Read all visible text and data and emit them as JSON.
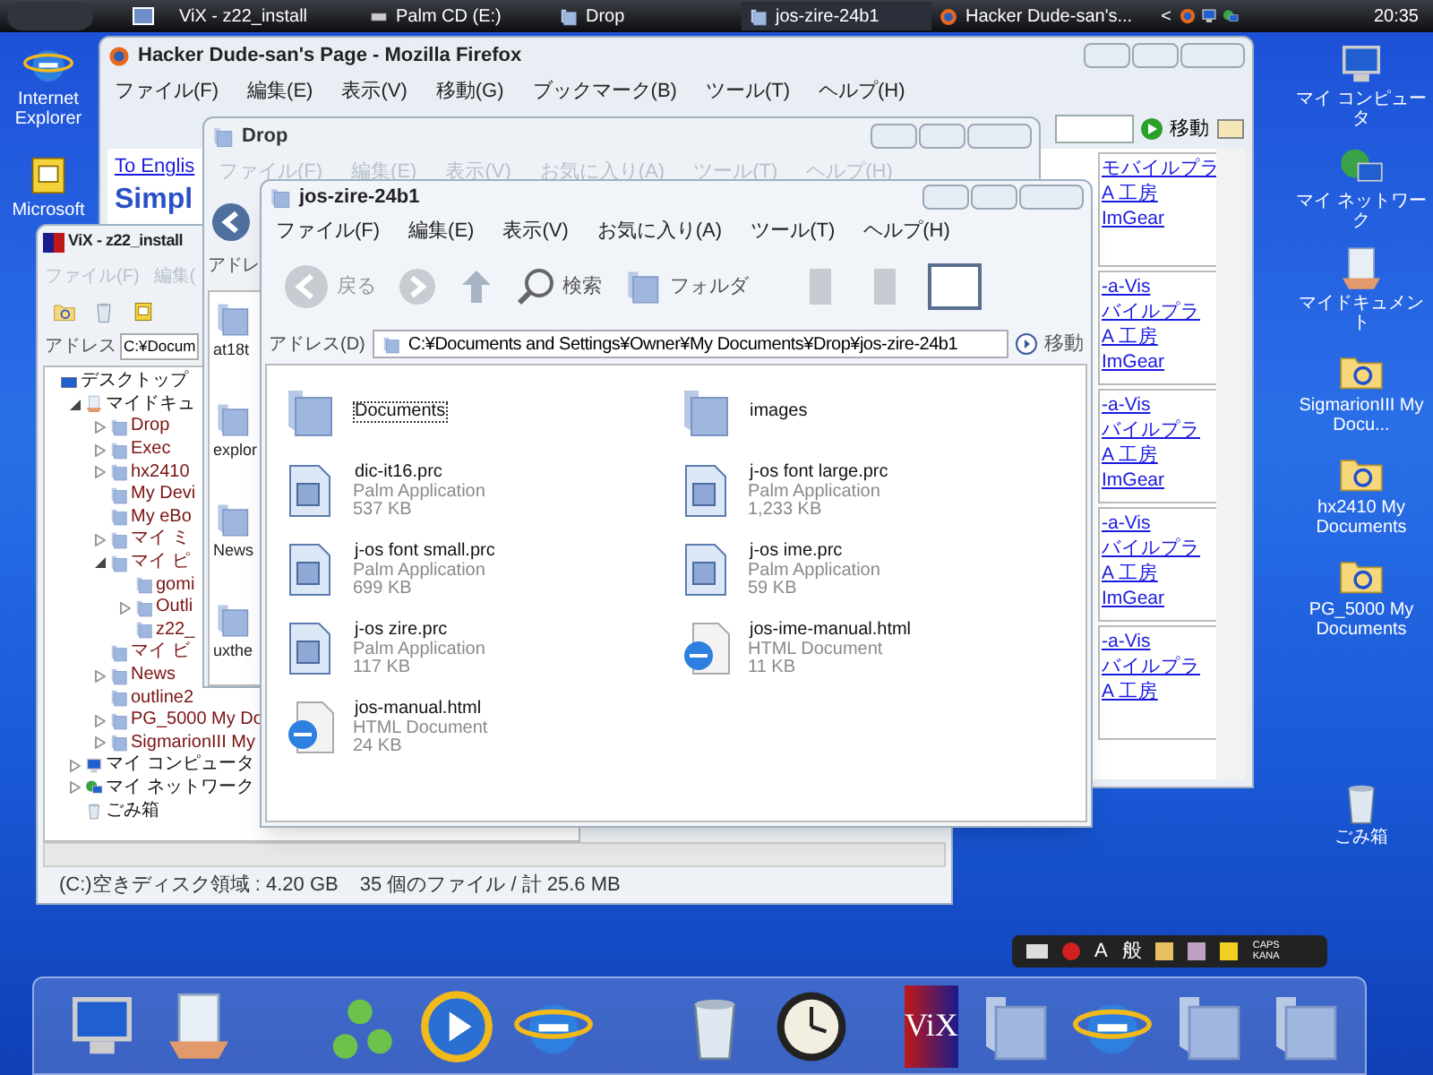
{
  "taskbar": {
    "tasks": [
      {
        "label": "ViX - z22_install",
        "kind": "vix",
        "selected": false
      },
      {
        "label": "Palm CD (E:)",
        "kind": "drive",
        "selected": false
      },
      {
        "label": "Drop",
        "kind": "folder",
        "selected": false
      },
      {
        "label": "jos-zire-24b1",
        "kind": "folder",
        "selected": true
      },
      {
        "label": "Hacker Dude-san's...",
        "kind": "browser",
        "selected": false
      }
    ],
    "tray_arrow": "<",
    "clock": "20:35"
  },
  "desktop_left": [
    {
      "label": "Internet Explorer",
      "kind": "ie"
    },
    {
      "label": "Microsoft",
      "kind": "app"
    }
  ],
  "desktop_right": [
    {
      "label": "マイ コンピュータ",
      "kind": "computer"
    },
    {
      "label": "マイ ネットワーク",
      "kind": "network"
    },
    {
      "label": "マイドキュメント",
      "kind": "docs"
    },
    {
      "label": "SigmarionIII My Docu...",
      "kind": "sync"
    },
    {
      "label": "hx2410 My Documents",
      "kind": "sync"
    },
    {
      "label": "PG_5000 My Documents",
      "kind": "sync"
    },
    {
      "label": "ごみ箱",
      "kind": "trash"
    }
  ],
  "firefox": {
    "title": "Hacker Dude-san's Page - Mozilla Firefox",
    "menu": [
      "ファイル(F)",
      "編集(E)",
      "表示(V)",
      "移動(G)",
      "ブックマーク(B)",
      "ツール(T)",
      "ヘルプ(H)"
    ],
    "go": "移動",
    "english_link": "To Englis",
    "heading": "Simpl",
    "link_groups": [
      [
        "モバイルプラ",
        "A 工房",
        "ImGear"
      ],
      [
        "-a-Vis",
        "バイルプラ",
        "A 工房",
        "ImGear"
      ],
      [
        "-a-Vis",
        "バイルプラ",
        "A 工房",
        "ImGear"
      ],
      [
        "-a-Vis",
        "バイルプラ",
        "A 工房",
        "ImGear"
      ],
      [
        "-a-Vis",
        "バイルプラ",
        "A 工房"
      ]
    ]
  },
  "vix": {
    "title": "ViX - z22_install",
    "menu": [
      "ファイル(F)",
      "編集("
    ],
    "address_label": "アドレス",
    "address": "C:¥Docum",
    "tree": [
      {
        "label": "デスクトップ",
        "kind": "desktop",
        "children": [
          {
            "label": "マイドキュ",
            "kind": "docs",
            "expanded": true,
            "children": [
              {
                "label": "Drop",
                "kind": "folder",
                "expanded": false
              },
              {
                "label": "Exec",
                "kind": "folder",
                "expanded": false
              },
              {
                "label": "hx2410",
                "kind": "folder",
                "expanded": false
              },
              {
                "label": "My Devi",
                "kind": "folder"
              },
              {
                "label": "My eBo",
                "kind": "folder"
              },
              {
                "label": "マイ ミ",
                "kind": "folder",
                "expanded": false
              },
              {
                "label": "マイ ピ",
                "kind": "folder",
                "expanded": true,
                "children": [
                  {
                    "label": "gomi",
                    "kind": "folder"
                  },
                  {
                    "label": "Outli",
                    "kind": "folder",
                    "expanded": false
                  },
                  {
                    "label": "z22_",
                    "kind": "folder"
                  }
                ]
              },
              {
                "label": "マイ ビ",
                "kind": "folder"
              },
              {
                "label": "News",
                "kind": "folder",
                "expanded": false
              },
              {
                "label": "outline2",
                "kind": "folder"
              },
              {
                "label": "PG_5000 My Do",
                "kind": "folder",
                "expanded": false
              },
              {
                "label": "SigmarionIII My",
                "kind": "folder",
                "expanded": false
              }
            ]
          },
          {
            "label": "マイ コンピュータ",
            "kind": "computer",
            "expanded": false
          },
          {
            "label": "マイ ネットワーク",
            "kind": "network",
            "expanded": false
          },
          {
            "label": "ごみ箱",
            "kind": "trash"
          }
        ]
      }
    ],
    "status": [
      "(C:)空きディスク領域 : 4.20 GB",
      "35 個のファイル / 計 25.6 MB"
    ]
  },
  "drop": {
    "title": "Drop",
    "menu": [
      "ファイル(F)",
      "編集(E)",
      "表示(V)",
      "お気に入り(A)",
      "ツール(T)",
      "ヘルプ(H)"
    ],
    "address_label": "アドレ",
    "files": [
      "at18t",
      "explor",
      "News",
      "uxthe"
    ]
  },
  "explorer": {
    "title": "jos-zire-24b1",
    "menu": [
      "ファイル(F)",
      "編集(E)",
      "表示(V)",
      "お気に入り(A)",
      "ツール(T)",
      "ヘルプ(H)"
    ],
    "back": "戻る",
    "search": "検索",
    "folders": "フォルダ",
    "address_label": "アドレス(D)",
    "address": "C:¥Documents and Settings¥Owner¥My Documents¥Drop¥jos-zire-24b1",
    "go": "移動",
    "files": [
      {
        "name": "Documents",
        "kind": "folder",
        "selected": true
      },
      {
        "name": "images",
        "kind": "folder",
        "selected": false
      },
      {
        "name": "dic-it16.prc",
        "kind": "palm",
        "type": "Palm Application",
        "size": "537 KB",
        "selected": false
      },
      {
        "name": "j-os font large.prc",
        "kind": "palm",
        "type": "Palm Application",
        "size": "1,233 KB",
        "selected": false
      },
      {
        "name": "j-os font small.prc",
        "kind": "palm",
        "type": "Palm Application",
        "size": "699 KB",
        "selected": false
      },
      {
        "name": "j-os ime.prc",
        "kind": "palm",
        "type": "Palm Application",
        "size": "59 KB",
        "selected": false
      },
      {
        "name": "j-os zire.prc",
        "kind": "palm",
        "type": "Palm Application",
        "size": "117 KB",
        "selected": false
      },
      {
        "name": "jos-ime-manual.html",
        "kind": "html",
        "type": "HTML Document",
        "size": "11 KB",
        "selected": false
      },
      {
        "name": "jos-manual.html",
        "kind": "html",
        "type": "HTML Document",
        "size": "24 KB",
        "selected": false
      }
    ]
  },
  "ime_bar": {
    "mode": "A",
    "kanji": "般",
    "caps": "CAPS",
    "kana": "KANA"
  },
  "dock": {
    "vix_label": "ViX",
    "icons": [
      {
        "kind": "computer"
      },
      {
        "kind": "docs"
      },
      {
        "kind": "messenger"
      },
      {
        "kind": "media"
      },
      {
        "kind": "ie"
      },
      {
        "kind": "trash"
      },
      {
        "kind": "clock"
      },
      {
        "kind": "vix"
      },
      {
        "kind": "folder"
      },
      {
        "kind": "ie"
      },
      {
        "kind": "folder"
      },
      {
        "kind": "folder"
      }
    ]
  }
}
